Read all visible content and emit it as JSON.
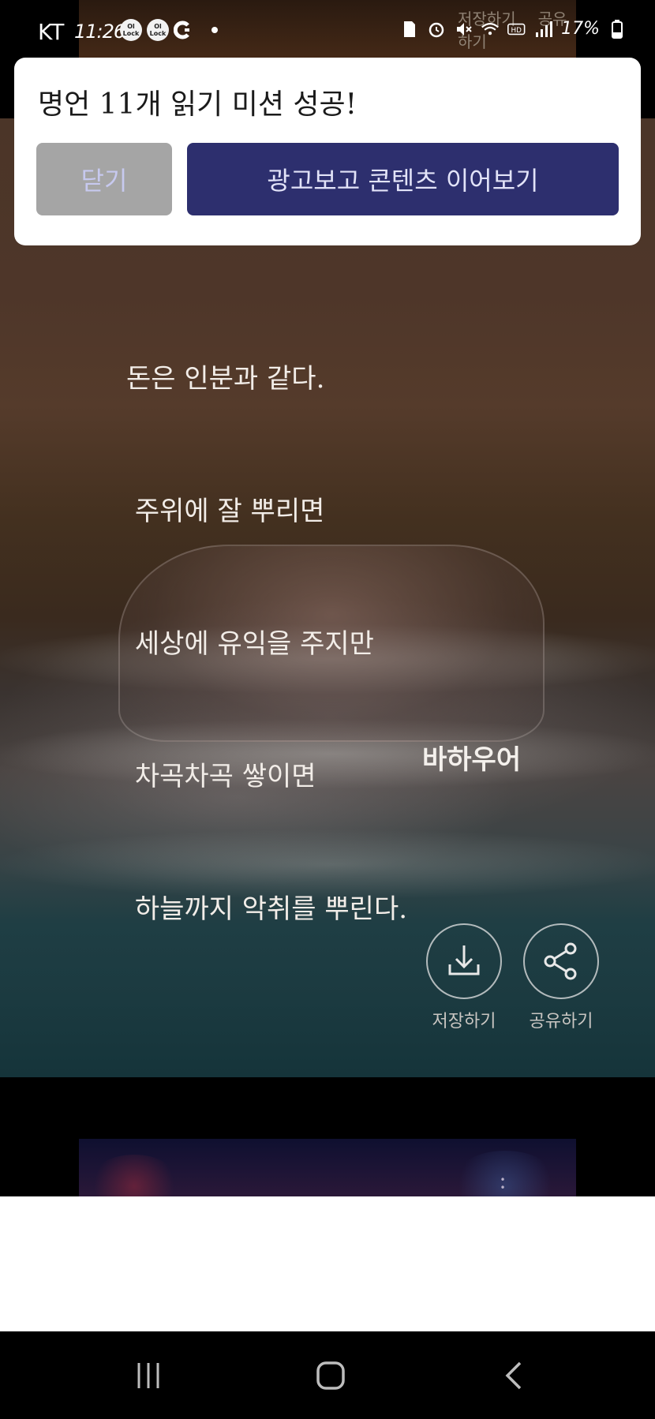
{
  "status_bar": {
    "carrier": "KT",
    "time": "11:26",
    "badges": [
      "Ol Lock",
      "Ol Lock"
    ],
    "battery": "17%",
    "icons": [
      "c-icon",
      "dot-icon",
      "sim-icon",
      "alarm-icon",
      "mute-icon",
      "wifi-icon",
      "hd-icon",
      "signal-icon",
      "battery-icon"
    ]
  },
  "background_card": {
    "save_label": "저장하기",
    "share_label": "공유하기"
  },
  "dialog": {
    "title": "명언 11개 읽기 미션 성공!",
    "close_label": "닫기",
    "continue_label": "광고보고 콘텐츠 이어보기"
  },
  "quote": {
    "lines": [
      "돈은 인분과 같다.",
      " 주위에 잘 뿌리면",
      " 세상에 유익을 주지만",
      " 차곡차곡 쌓이면",
      " 하늘까지 악취를 뿌린다."
    ],
    "author": "바하우어",
    "save_label": "저장하기",
    "share_label": "공유하기"
  },
  "nav_bar": {
    "icons": [
      "recents-icon",
      "home-icon",
      "back-icon"
    ]
  },
  "colors": {
    "dialog_bg": "#ffffff",
    "close_button_bg": "#a5a5a5",
    "continue_button_bg": "#2d2f6e",
    "quote_text": "#f2ede8"
  }
}
